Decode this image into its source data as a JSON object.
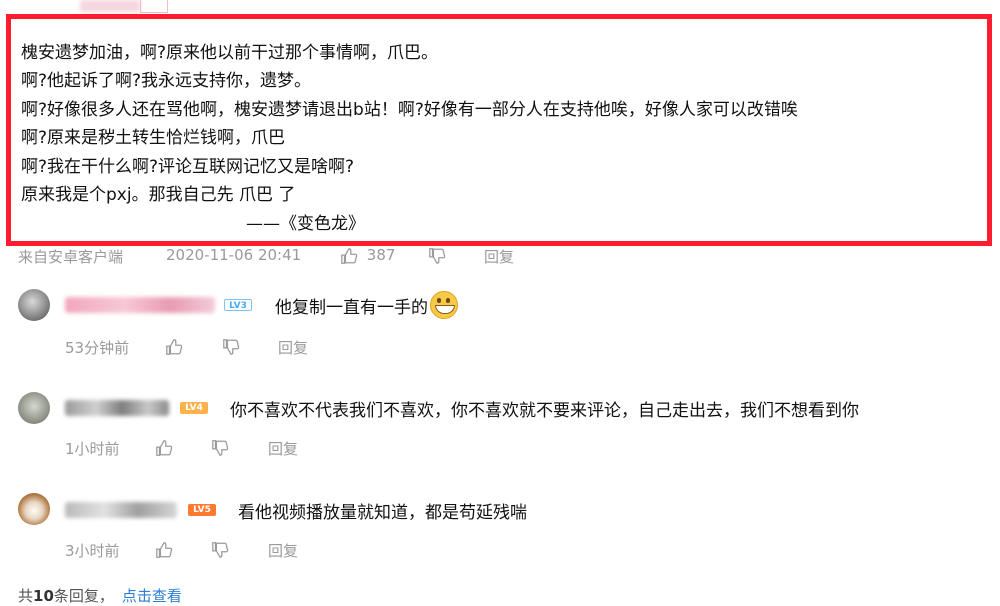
{
  "main_comment": {
    "lines": [
      "槐安遗梦加油，啊?原来他以前干过那个事情啊，爪巴。",
      "啊?他起诉了啊?我永远支持你，遗梦。",
      "啊?好像很多人还在骂他啊，槐安遗梦请退出b站！啊?好像有一部分人在支持他唉，好像人家可以改错唉",
      "啊?原来是秽土转生恰烂钱啊，爪巴",
      "啊?我在干什么啊?评论互联网记忆又是啥啊?",
      "原来我是个pxj。那我自己先 爪巴 了"
    ],
    "signature": "——《变色龙》",
    "highlight_color": "#ff1c2e",
    "meta": {
      "source": "来自安卓客户端",
      "timestamp": "2020-11-06 20:41",
      "like_count": "387",
      "reply_label": "回复"
    }
  },
  "replies": [
    {
      "level": "LV3",
      "text": "他复制一直有一手的",
      "emoji": "grin-emoji",
      "time": "53分钟前",
      "reply_label": "回复"
    },
    {
      "level": "LV4",
      "text": "你不喜欢不代表我们不喜欢，你不喜欢就不要来评论，自己走出去，我们不想看到你",
      "time": "1小时前",
      "reply_label": "回复"
    },
    {
      "level": "LV5",
      "text": "看他视频播放量就知道，都是苟延残喘",
      "time": "3小时前",
      "reply_label": "回复"
    }
  ],
  "footer": {
    "prefix": "共",
    "count": "10",
    "suffix": "条回复，",
    "view_link": "点击查看"
  },
  "colors": {
    "lv3": "#4aa9f5",
    "lv4": "#ffb14b",
    "lv5": "#ff7a2e",
    "link": "#2b7fd6"
  }
}
